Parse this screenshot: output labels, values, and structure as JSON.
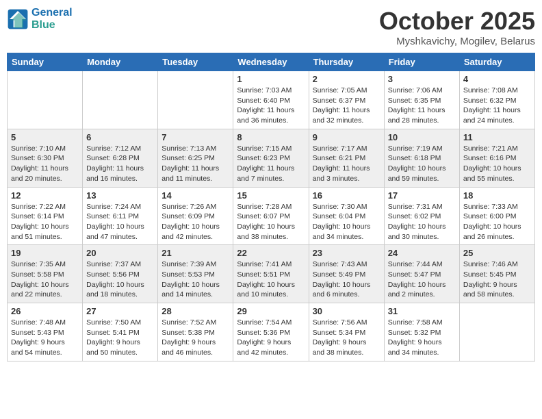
{
  "logo": {
    "line1": "General",
    "line2": "Blue"
  },
  "title": "October 2025",
  "location": "Myshkavichy, Mogilev, Belarus",
  "days_of_week": [
    "Sunday",
    "Monday",
    "Tuesday",
    "Wednesday",
    "Thursday",
    "Friday",
    "Saturday"
  ],
  "weeks": [
    [
      {
        "day": "",
        "info": ""
      },
      {
        "day": "",
        "info": ""
      },
      {
        "day": "",
        "info": ""
      },
      {
        "day": "1",
        "info": "Sunrise: 7:03 AM\nSunset: 6:40 PM\nDaylight: 11 hours\nand 36 minutes."
      },
      {
        "day": "2",
        "info": "Sunrise: 7:05 AM\nSunset: 6:37 PM\nDaylight: 11 hours\nand 32 minutes."
      },
      {
        "day": "3",
        "info": "Sunrise: 7:06 AM\nSunset: 6:35 PM\nDaylight: 11 hours\nand 28 minutes."
      },
      {
        "day": "4",
        "info": "Sunrise: 7:08 AM\nSunset: 6:32 PM\nDaylight: 11 hours\nand 24 minutes."
      }
    ],
    [
      {
        "day": "5",
        "info": "Sunrise: 7:10 AM\nSunset: 6:30 PM\nDaylight: 11 hours\nand 20 minutes."
      },
      {
        "day": "6",
        "info": "Sunrise: 7:12 AM\nSunset: 6:28 PM\nDaylight: 11 hours\nand 16 minutes."
      },
      {
        "day": "7",
        "info": "Sunrise: 7:13 AM\nSunset: 6:25 PM\nDaylight: 11 hours\nand 11 minutes."
      },
      {
        "day": "8",
        "info": "Sunrise: 7:15 AM\nSunset: 6:23 PM\nDaylight: 11 hours\nand 7 minutes."
      },
      {
        "day": "9",
        "info": "Sunrise: 7:17 AM\nSunset: 6:21 PM\nDaylight: 11 hours\nand 3 minutes."
      },
      {
        "day": "10",
        "info": "Sunrise: 7:19 AM\nSunset: 6:18 PM\nDaylight: 10 hours\nand 59 minutes."
      },
      {
        "day": "11",
        "info": "Sunrise: 7:21 AM\nSunset: 6:16 PM\nDaylight: 10 hours\nand 55 minutes."
      }
    ],
    [
      {
        "day": "12",
        "info": "Sunrise: 7:22 AM\nSunset: 6:14 PM\nDaylight: 10 hours\nand 51 minutes."
      },
      {
        "day": "13",
        "info": "Sunrise: 7:24 AM\nSunset: 6:11 PM\nDaylight: 10 hours\nand 47 minutes."
      },
      {
        "day": "14",
        "info": "Sunrise: 7:26 AM\nSunset: 6:09 PM\nDaylight: 10 hours\nand 42 minutes."
      },
      {
        "day": "15",
        "info": "Sunrise: 7:28 AM\nSunset: 6:07 PM\nDaylight: 10 hours\nand 38 minutes."
      },
      {
        "day": "16",
        "info": "Sunrise: 7:30 AM\nSunset: 6:04 PM\nDaylight: 10 hours\nand 34 minutes."
      },
      {
        "day": "17",
        "info": "Sunrise: 7:31 AM\nSunset: 6:02 PM\nDaylight: 10 hours\nand 30 minutes."
      },
      {
        "day": "18",
        "info": "Sunrise: 7:33 AM\nSunset: 6:00 PM\nDaylight: 10 hours\nand 26 minutes."
      }
    ],
    [
      {
        "day": "19",
        "info": "Sunrise: 7:35 AM\nSunset: 5:58 PM\nDaylight: 10 hours\nand 22 minutes."
      },
      {
        "day": "20",
        "info": "Sunrise: 7:37 AM\nSunset: 5:56 PM\nDaylight: 10 hours\nand 18 minutes."
      },
      {
        "day": "21",
        "info": "Sunrise: 7:39 AM\nSunset: 5:53 PM\nDaylight: 10 hours\nand 14 minutes."
      },
      {
        "day": "22",
        "info": "Sunrise: 7:41 AM\nSunset: 5:51 PM\nDaylight: 10 hours\nand 10 minutes."
      },
      {
        "day": "23",
        "info": "Sunrise: 7:43 AM\nSunset: 5:49 PM\nDaylight: 10 hours\nand 6 minutes."
      },
      {
        "day": "24",
        "info": "Sunrise: 7:44 AM\nSunset: 5:47 PM\nDaylight: 10 hours\nand 2 minutes."
      },
      {
        "day": "25",
        "info": "Sunrise: 7:46 AM\nSunset: 5:45 PM\nDaylight: 9 hours\nand 58 minutes."
      }
    ],
    [
      {
        "day": "26",
        "info": "Sunrise: 7:48 AM\nSunset: 5:43 PM\nDaylight: 9 hours\nand 54 minutes."
      },
      {
        "day": "27",
        "info": "Sunrise: 7:50 AM\nSunset: 5:41 PM\nDaylight: 9 hours\nand 50 minutes."
      },
      {
        "day": "28",
        "info": "Sunrise: 7:52 AM\nSunset: 5:38 PM\nDaylight: 9 hours\nand 46 minutes."
      },
      {
        "day": "29",
        "info": "Sunrise: 7:54 AM\nSunset: 5:36 PM\nDaylight: 9 hours\nand 42 minutes."
      },
      {
        "day": "30",
        "info": "Sunrise: 7:56 AM\nSunset: 5:34 PM\nDaylight: 9 hours\nand 38 minutes."
      },
      {
        "day": "31",
        "info": "Sunrise: 7:58 AM\nSunset: 5:32 PM\nDaylight: 9 hours\nand 34 minutes."
      },
      {
        "day": "",
        "info": ""
      }
    ]
  ]
}
